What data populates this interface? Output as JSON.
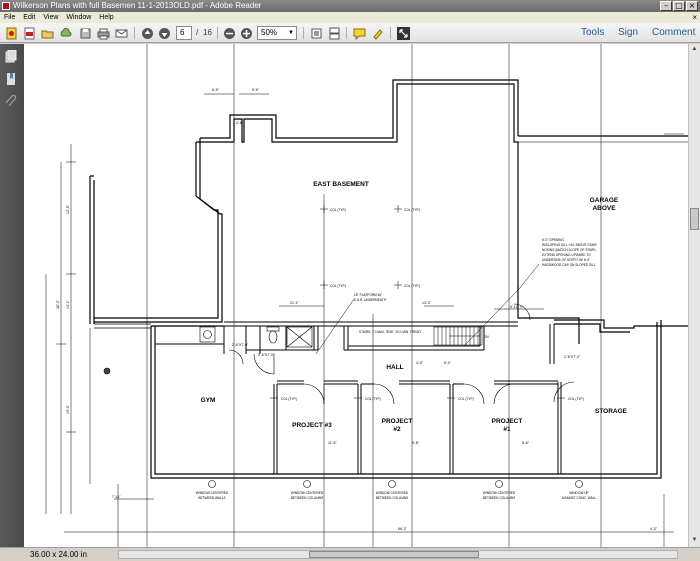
{
  "window": {
    "title": "Wilkerson Plans with full Basemen 11-1-2013OLD.pdf - Adobe Reader"
  },
  "menu": [
    "File",
    "Edit",
    "View",
    "Window",
    "Help"
  ],
  "toolbar": {
    "current_page": "6",
    "page_separator": "/",
    "total_pages": "16",
    "zoom": "50%",
    "tools_label": "Tools",
    "sign_label": "Sign",
    "comment_label": "Comment"
  },
  "status": {
    "page_size": "36.00 x 24.00 in"
  },
  "plan": {
    "rooms": {
      "east_basement": "EAST BASEMENT",
      "garage_line1": "GARAGE",
      "garage_line2": "ABOVE",
      "gym": "GYM",
      "hall": "HALL",
      "project3": "PROJECT #3",
      "project2_line1": "PROJECT",
      "project2_line2": "#2",
      "project1_line1": "PROJECT",
      "project1_line2": "#1",
      "storage": "STORAGE"
    },
    "notes": {
      "col_typ": "COL (TYP.)",
      "platform_line1": "18\" PLATFORM W/",
      "platform_line2": "E.A.R. UNDERNEATH",
      "stairs": "STAIRS: 7.0 MAX. RISE, 10.0 MIN. TREAD",
      "opening_1": "6'-0\" OPENING",
      "opening_2": "W/SLOPING SILL +34\" ABOVE STAIR",
      "opening_3": "NOSING (MATCH SLOPE OF STAIR)",
      "opening_4": "EXTEND OPENING UPWARD TO",
      "opening_5": "UNDERSIDE OF SOFFIT W/ 6'-0\"",
      "opening_6": "HARDWOOD CAP ON SLOPED SILL",
      "window_walls_1": "WINDOW CENTERED",
      "window_walls_2": "BETWEEN WALLS",
      "window_cols_1": "WINDOW CENTERED",
      "window_cols_2": "BETWEEN COLUMNS",
      "window_up_1": "WINDOW UP",
      "window_up_2": "AGAINST CONC. WALL",
      "dn": "DN"
    },
    "dims": {
      "d_6_9": "6'-9\"",
      "d_5_6": "5'-6\"",
      "d_2_6": "2'-6\"",
      "d_21_1": "21'-1\"",
      "d_13_3": "13'-3\"",
      "d_6_11": "6'-11\" +/-",
      "d_2_6b": "2'-6\"X7'-0\"",
      "d_4_0": "4'-0\"",
      "d_5_0": "5'-0\"",
      "d_7_11": "7'-11\"",
      "d_48_0": "48'-0\"",
      "d_11_6": "11'-6\"",
      "d_9_8": "9'-8\"",
      "d_8_6": "8'-6\"",
      "d_12_5": "12'-5\"",
      "d_14_1": "14'-1\"",
      "d_19_0": "19'-0\"",
      "d_66_2": "66'-2\"",
      "d_4_3": "4'-3\""
    }
  }
}
